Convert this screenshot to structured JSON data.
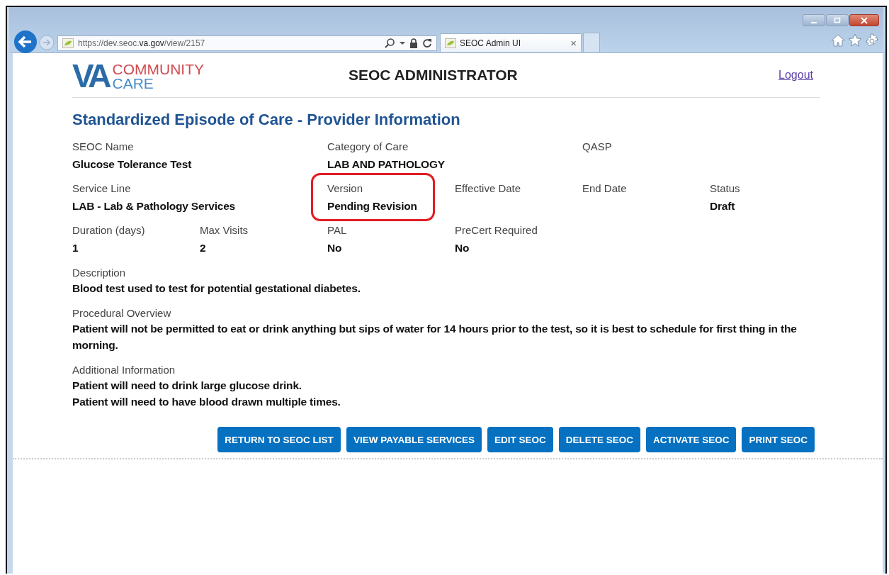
{
  "browser": {
    "url": "https://dev.seoc.**va.gov**/view/2157",
    "tab_title": "SEOC Admin UI",
    "tab_close": "×"
  },
  "header": {
    "logo": {
      "mark": "VA",
      "line1": "COMMUNITY",
      "line2": "CARE"
    },
    "title": "SEOC ADMINISTRATOR",
    "logout": "Logout"
  },
  "page_title": "Standardized Episode of Care - Provider Information",
  "field_rows": [
    [
      {
        "label": "SEOC Name",
        "value": "Glucose Tolerance Test",
        "highlighted": false
      },
      {
        "label": "Category of Care",
        "value": "LAB AND PATHOLOGY",
        "highlighted": false
      },
      {
        "label": "QASP",
        "highlighted": false
      }
    ],
    [
      {
        "label": "Service Line",
        "value": "LAB - Lab & Pathology Services",
        "highlighted": false
      },
      {
        "label": "Version",
        "value": "Pending Revision",
        "highlighted": true
      },
      {
        "label": "Effective Date",
        "highlighted": false
      },
      {
        "label": "End Date",
        "highlighted": false
      },
      {
        "label": "Status",
        "value": "Draft",
        "highlighted": false
      }
    ],
    [
      {
        "label": "Duration (days)",
        "value": "1",
        "highlighted": false
      },
      {
        "label": "Max Visits",
        "value": "2",
        "highlighted": false
      },
      {
        "label": "PAL",
        "value": "No",
        "highlighted": false
      },
      {
        "label": "PreCert Required",
        "value": "No",
        "highlighted": false
      }
    ]
  ],
  "sections": [
    {
      "label": "Description",
      "lines": [
        "Blood test used to test for potential gestational diabetes."
      ]
    },
    {
      "label": "Procedural Overview",
      "lines": [
        "Patient will not be permitted to eat or drink anything but sips of water for 14 hours prior to the test, so it is best to schedule for first thing in the morning."
      ]
    },
    {
      "label": "Additional Information",
      "lines": [
        "Patient will need to drink large glucose drink.",
        "Patient will need to have blood drawn multiple times."
      ]
    }
  ],
  "buttons": [
    "RETURN TO SEOC LIST",
    "VIEW PAYABLE SERVICES",
    "EDIT SEOC",
    "DELETE SEOC",
    "ACTIVATE SEOC",
    "PRINT SEOC"
  ]
}
